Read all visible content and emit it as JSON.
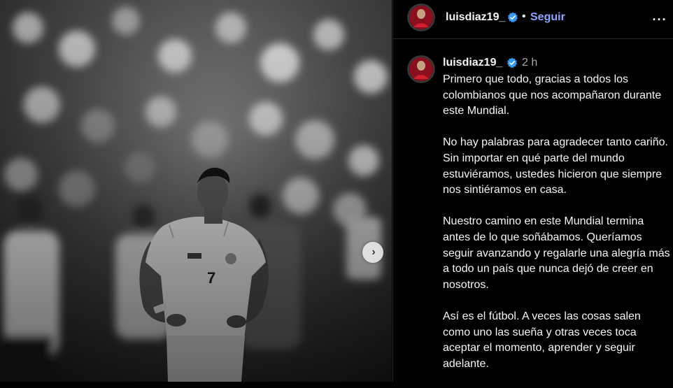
{
  "post": {
    "username": "luisdiaz19_",
    "verified": true,
    "follow_label": "Seguir",
    "separator": "•",
    "more_icon": "more-horizontal-icon"
  },
  "caption": {
    "username": "luisdiaz19_",
    "time": "2 h",
    "paragraphs": [
      "Primero que todo, gracias a todos los colombianos que nos acompañaron durante este Mundial.",
      "No hay palabras para agradecer tanto cariño. Sin importar en qué parte del mundo estuviéramos, ustedes hicieron que siempre nos sintiéramos en casa.",
      "Nuestro camino en este Mundial termina antes de lo que soñábamos. Queríamos seguir avanzando y regalarle una alegría más a todo un país que nunca dejó de creer en nosotros.",
      "Así es el fútbol. A veces las cosas salen como uno las sueña y otras veces toca aceptar el momento, aprender y seguir adelante."
    ]
  },
  "photo": {
    "jersey_number": "7",
    "next_icon": "chevron-right-icon"
  },
  "colors": {
    "background": "#000000",
    "link": "#8ea6ff",
    "verified": "#3897f0",
    "muted": "#a8a8a8"
  }
}
